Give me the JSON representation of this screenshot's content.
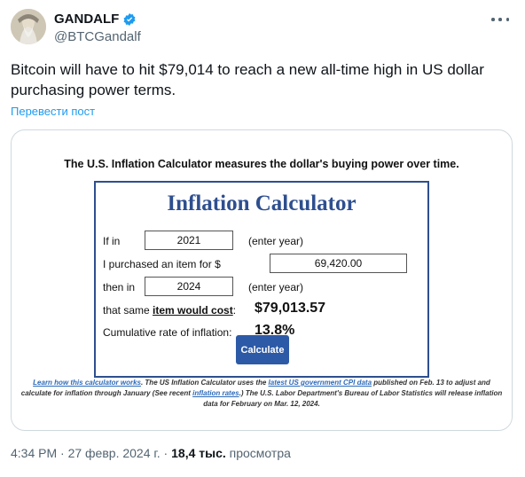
{
  "tweet": {
    "display_name": "GANDALF",
    "handle": "@BTCGandalf",
    "text": "Bitcoin will have to hit $79,014 to reach a new all-time high in US dollar purchasing power terms.",
    "translate_label": "Перевести пост",
    "accent_color": "#1d9bf0"
  },
  "media": {
    "headline": "The U.S. Inflation Calculator measures the dollar's buying power over time.",
    "calculator": {
      "title": "Inflation Calculator",
      "if_in_label": "If in",
      "start_year": "2021",
      "enter_year_hint": "(enter year)",
      "purchased_label": "I purchased an item for $",
      "amount": "69,420.00",
      "then_in_label": "then in",
      "end_year": "2024",
      "cost_label_prefix": "that same ",
      "cost_label_link": "item would cost",
      "cost_label_suffix": ":",
      "cost_value": "$79,013.57",
      "cumulative_label": "Cumulative rate of inflation:",
      "cumulative_value": "13.8%",
      "calculate_button": "Calculate",
      "brand_color": "#2e4f8f"
    },
    "footnote": {
      "link1": "Learn how this calculator works",
      "text1": ". The US Inflation Calculator uses the ",
      "link2": "latest US government CPI data",
      "text2": " published on Feb. 13 to adjust and calculate for inflation through January (See recent ",
      "link3": "inflation rates",
      "text3": ".) The U.S. Labor Department's Bureau of Labor Statistics will release inflation data for February on Mar. 12, 2024."
    }
  },
  "meta": {
    "time_date": "4:34 PM · 27 февр. 2024 г. · ",
    "views_count": "18,4 тыс.",
    "views_label": " просмотра"
  }
}
